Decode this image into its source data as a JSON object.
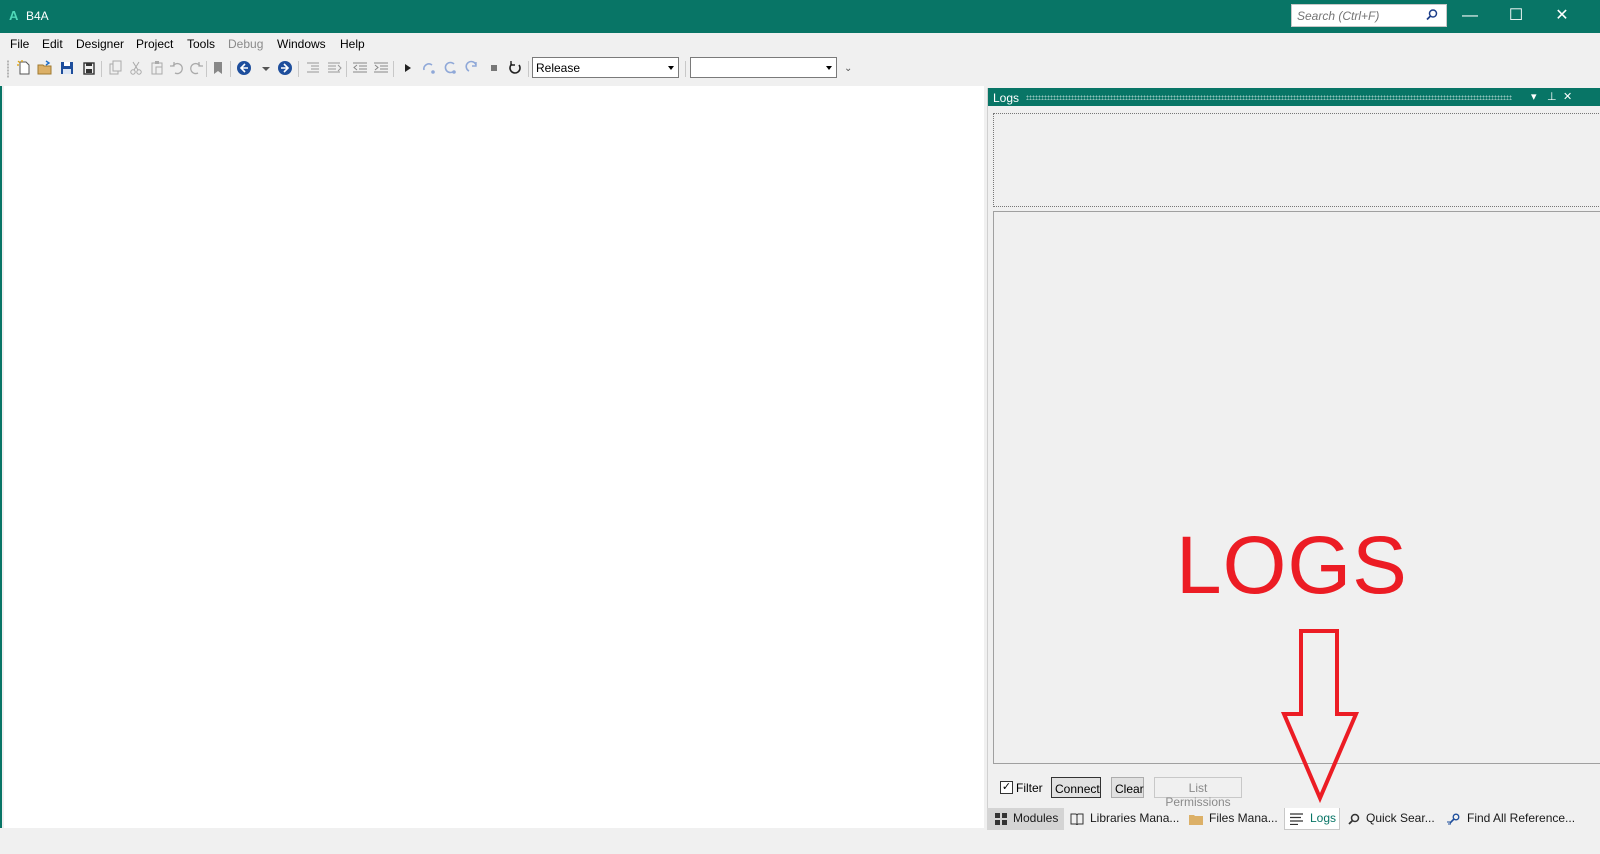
{
  "app": {
    "logo": "A",
    "title": "B4A"
  },
  "search": {
    "placeholder": "Search (Ctrl+F)"
  },
  "window_controls": {
    "minimize": "—",
    "maximize": "☐",
    "close": "✕"
  },
  "menu": [
    {
      "label": "File",
      "enabled": true
    },
    {
      "label": "Edit",
      "enabled": true
    },
    {
      "label": "Designer",
      "enabled": true
    },
    {
      "label": "Project",
      "enabled": true
    },
    {
      "label": "Tools",
      "enabled": true
    },
    {
      "label": "Debug",
      "enabled": false
    },
    {
      "label": "Windows",
      "enabled": true
    },
    {
      "label": "Help",
      "enabled": true
    }
  ],
  "toolbar": {
    "icons": [
      "new-file-icon",
      "open-icon",
      "save-icon",
      "save-all-icon",
      "copy-icon",
      "cut-icon",
      "paste-icon",
      "undo-icon",
      "redo-icon",
      "bookmark-icon",
      "back-icon",
      "back-dropdown-icon",
      "forward-icon",
      "comment-icon",
      "uncomment-icon",
      "outdent-icon",
      "indent-icon",
      "run-icon",
      "step-in-icon",
      "step-over-icon",
      "step-out-icon",
      "stop-icon",
      "restart-icon"
    ],
    "build_config": "Release",
    "device": "",
    "overflow": "⌄"
  },
  "logs": {
    "title": "Logs",
    "controls": {
      "dropdown": "▾",
      "pin": "⊥",
      "close": "✕"
    },
    "filter_label": "Filter",
    "filter_checked": true,
    "check_mark": "✓",
    "buttons": {
      "connect": "Connect",
      "clear": "Clear",
      "list_permissions": "List Permissions"
    }
  },
  "tabs": [
    {
      "label": "Modules",
      "icon": "modules-icon",
      "active": false
    },
    {
      "label": "Libraries Mana...",
      "icon": "book-icon",
      "active": false
    },
    {
      "label": "Files Mana...",
      "icon": "folder-icon",
      "active": false
    },
    {
      "label": "Logs",
      "icon": "logs-icon",
      "active": true
    },
    {
      "label": "Quick Sear...",
      "icon": "search-icon",
      "active": false
    },
    {
      "label": "Find All Reference...",
      "icon": "references-icon",
      "active": false
    }
  ],
  "annotation": {
    "text": "LOGS",
    "color": "#ec1c24"
  },
  "colors": {
    "accent": "#087566",
    "annotation": "#ec1c24"
  }
}
